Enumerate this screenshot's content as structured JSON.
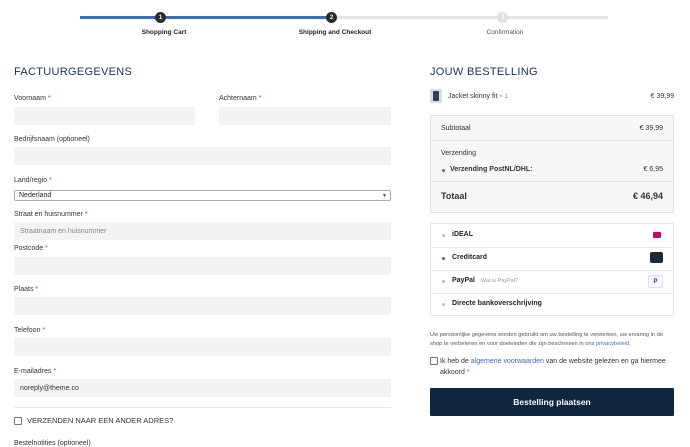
{
  "steps": [
    {
      "number": "1",
      "label": "Shopping Cart"
    },
    {
      "number": "2",
      "label": "Shipping and Checkout"
    },
    {
      "number": "3",
      "label": "Confirmation"
    }
  ],
  "billing": {
    "title": "FACTUURGEGEVENS",
    "first_name_label": "Voornaam",
    "last_name_label": "Achternaam",
    "company_label": "Bedrijfsnaam (optioneel)",
    "country_label": "Land/regio",
    "country_value": "Nederland",
    "street_label": "Straat en huisnummer",
    "street_placeholder": "Straatnaam en huisnummer",
    "postcode_label": "Postcode",
    "city_label": "Plaats",
    "phone_label": "Telefoon",
    "email_label": "E-mailadres",
    "email_value": "noreply@theme.co",
    "ship_different_label": "VERZENDEN NAAR EEN ANDER ADRES?",
    "order_notes_label": "Bestelnotities (optioneel)",
    "required_mark": "*"
  },
  "order": {
    "title": "JOUW BESTELLING",
    "product_name": "Jacket skinny fit",
    "product_qty": "× 1",
    "product_price": "€ 39,99",
    "subtotal_label": "Subtotaal",
    "subtotal_value": "€ 39,99",
    "shipping_label": "Verzending",
    "shipping_method": "Verzending PostNL/DHL:",
    "shipping_value": "€ 6,95",
    "total_label": "Totaal",
    "total_value": "€ 46,94"
  },
  "payment_methods": [
    {
      "name": "iDEAL",
      "icon": "ideal-icon",
      "selected": false
    },
    {
      "name": "Creditcard",
      "icon": "creditcard-icon",
      "selected": true
    },
    {
      "name": "PayPal",
      "sub": "Wat is PayPal?",
      "icon": "paypal-icon",
      "selected": false
    },
    {
      "name": "Directe bankoverschrijving",
      "selected": false
    }
  ],
  "privacy": {
    "text": "Uw persoonlijke gegevens worden gebruikt om uw bestelling te verwerken, uw ervaring in de shop te verbeteren en voor doeleinden die zijn beschreven in ons",
    "link": "privacybeleid",
    "end": "."
  },
  "terms": {
    "prefix": "Ik heb de",
    "link": "algemene voorwaarden",
    "suffix": "van de website gelezen en ga hiermee akkoord"
  },
  "place_order_label": "Bestelling plaatsen",
  "colors": {
    "accent": "#3b6fb5",
    "button": "#0f2540",
    "heading": "#1a3250"
  }
}
